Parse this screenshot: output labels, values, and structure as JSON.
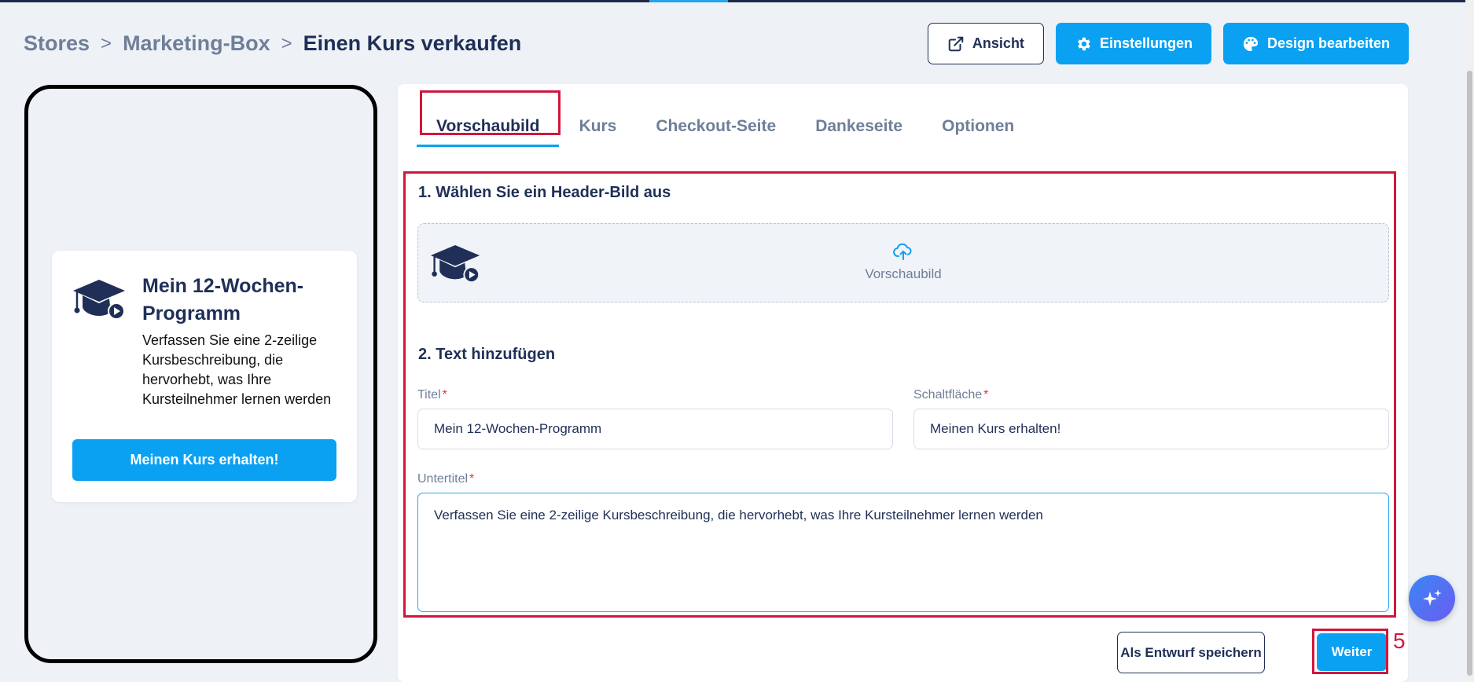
{
  "breadcrumb": {
    "items": [
      "Stores",
      "Marketing-Box",
      "Einen Kurs verkaufen"
    ],
    "separator": ">"
  },
  "header": {
    "view_label": "Ansicht",
    "settings_label": "Einstellungen",
    "design_label": "Design bearbeiten"
  },
  "preview": {
    "title": "Mein 12-Wochen-Programm",
    "subtitle": "Verfassen Sie eine 2-zeilige Kursbeschreibung, die hervorhebt, was Ihre Kursteilnehmer lernen werden",
    "button_label": "Meinen Kurs erhalten!"
  },
  "tabs": [
    "Vorschaubild",
    "Kurs",
    "Checkout-Seite",
    "Dankeseite",
    "Optionen"
  ],
  "active_tab": "Vorschaubild",
  "form": {
    "section1_title": "1. Wählen Sie ein Header-Bild aus",
    "upload_label": "Vorschaubild",
    "section2_title": "2. Text hinzufügen",
    "title_label": "Titel",
    "title_value": "Mein 12-Wochen-Programm",
    "button_field_label": "Schaltfläche",
    "button_field_value": "Meinen Kurs erhalten!",
    "subtitle_label": "Untertitel",
    "subtitle_value": "Verfassen Sie eine 2-zeilige Kursbeschreibung, die hervorhebt, was Ihre Kursteilnehmer lernen werden",
    "required_mark": "*"
  },
  "footer": {
    "draft_label": "Als Entwurf speichern",
    "next_label": "Weiter",
    "step_annotation": "5"
  },
  "colors": {
    "primary": "#0aa1f2",
    "navy": "#1f2f57",
    "highlight": "#d0173c",
    "muted": "#6f7f99"
  },
  "icons": {
    "view": "external-link-icon",
    "settings": "gear-icon",
    "design": "palette-icon",
    "course": "graduation-cap-icon",
    "upload": "cloud-upload-icon",
    "assistant": "sparkles-icon"
  }
}
